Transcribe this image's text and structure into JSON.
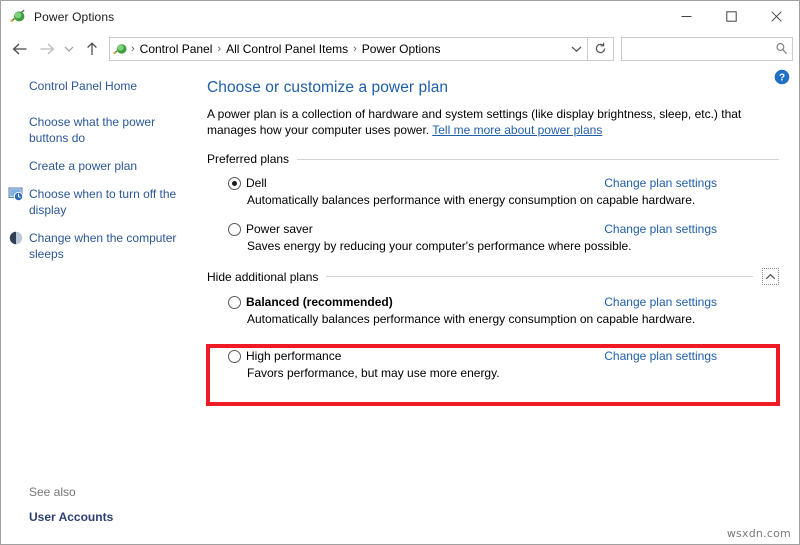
{
  "window": {
    "title": "Power Options",
    "title_icon": "power-plug-icon",
    "controls": {
      "minimize": "Minimize",
      "maximize": "Maximize",
      "close": "Close"
    }
  },
  "navbar": {
    "back": "Back",
    "forward": "Forward",
    "recent": "Recent locations",
    "up": "Up",
    "breadcrumb": [
      "Control Panel",
      "All Control Panel Items",
      "Power Options"
    ],
    "separator": "›",
    "dropdown": "Previous locations",
    "refresh": "Refresh",
    "search_value": "",
    "search_placeholder": ""
  },
  "sidebar": {
    "items": [
      {
        "label": "Control Panel Home",
        "icon": ""
      },
      {
        "label": "Choose what the power buttons do",
        "icon": ""
      },
      {
        "label": "Create a power plan",
        "icon": ""
      },
      {
        "label": "Choose when to turn off the display",
        "icon": "monitor-icon"
      },
      {
        "label": "Change when the computer sleeps",
        "icon": "moon-icon"
      }
    ],
    "see_also_label": "See also",
    "see_also_link": "User Accounts"
  },
  "main": {
    "help": "Help",
    "title": "Choose or customize a power plan",
    "description_part1": "A power plan is a collection of hardware and system settings (like display brightness, sleep, etc.) that manages how your computer uses power. ",
    "description_link": "Tell me more about power plans",
    "sections": [
      {
        "label": "Preferred plans",
        "collapse_icon": "",
        "plans": [
          {
            "name": "Dell",
            "selected": true,
            "bold": false,
            "description": "Automatically balances performance with energy consumption on capable hardware.",
            "link": "Change plan settings"
          },
          {
            "name": "Power saver",
            "selected": false,
            "bold": false,
            "description": "Saves energy by reducing your computer's performance where possible.",
            "link": "Change plan settings"
          }
        ]
      },
      {
        "label": "Hide additional plans",
        "collapse_icon": "chevron-up-icon",
        "plans": [
          {
            "name": "Balanced (recommended)",
            "selected": false,
            "bold": true,
            "description": "Automatically balances performance with energy consumption on capable hardware.",
            "link": "Change plan settings"
          },
          {
            "name": "High performance",
            "selected": false,
            "bold": false,
            "description": "Favors performance, but may use more energy.",
            "link": "Change plan settings"
          }
        ]
      }
    ]
  },
  "annotation": {
    "highlight_color": "#ee1b24"
  },
  "watermark": "wsxdn.com"
}
